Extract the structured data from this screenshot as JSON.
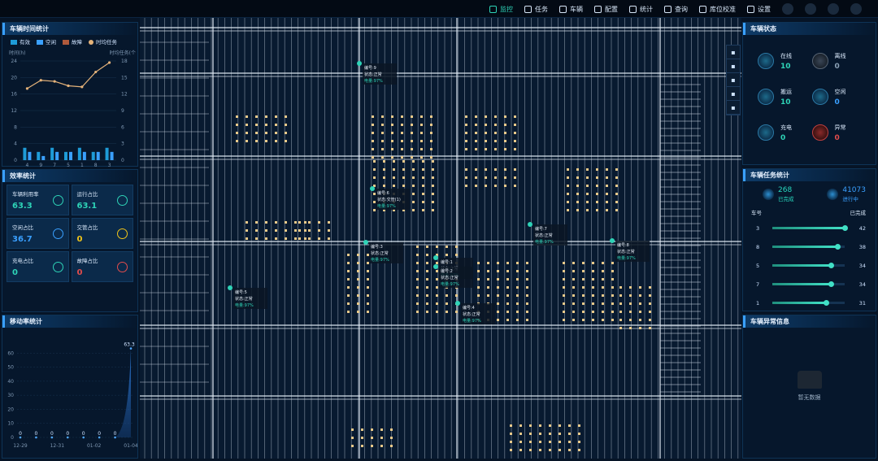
{
  "nav": {
    "items": [
      {
        "label": "监控",
        "icon": "monitor-icon",
        "active": true
      },
      {
        "label": "任务",
        "icon": "task-icon"
      },
      {
        "label": "车辆",
        "icon": "vehicle-icon"
      },
      {
        "label": "配置",
        "icon": "config-icon"
      },
      {
        "label": "统计",
        "icon": "stats-icon"
      },
      {
        "label": "查询",
        "icon": "query-icon"
      },
      {
        "label": "库位校准",
        "icon": "calibrate-icon"
      },
      {
        "label": "设置",
        "icon": "settings-icon"
      }
    ]
  },
  "vehicle_time": {
    "title": "车辆时间统计",
    "legend": [
      "有效",
      "空闲",
      "故障",
      "时均任务"
    ],
    "left_axis_label": "时间(h)",
    "right_axis_label": "时均任务(个",
    "colors": {
      "effective": "#1e9bd7",
      "idle": "#3aa0ff",
      "fault": "#b05a3c",
      "avg": "#e5b37a"
    }
  },
  "efficiency": {
    "title": "效率统计",
    "cells": [
      {
        "label": "车辆利用率",
        "value": "63.3",
        "color": "#2ed3b7",
        "icon": "utilization-icon"
      },
      {
        "label": "运行占比",
        "value": "63.1",
        "color": "#2ed3b7",
        "icon": "running-icon"
      },
      {
        "label": "空闲占比",
        "value": "36.7",
        "color": "#3aa0ff",
        "icon": "idle-icon"
      },
      {
        "label": "交管占比",
        "value": "0",
        "color": "#f0c419",
        "icon": "traffic-icon"
      },
      {
        "label": "充电占比",
        "value": "0",
        "color": "#2ed3b7",
        "icon": "charging-icon"
      },
      {
        "label": "故障占比",
        "value": "0",
        "color": "#e24c4c",
        "icon": "fault-icon"
      }
    ]
  },
  "mobility": {
    "title": "移动率统计"
  },
  "vehicle_status": {
    "title": "车辆状态",
    "items": [
      {
        "label": "在线",
        "value": "10",
        "color": "#2ed3b7",
        "icon": "online-icon"
      },
      {
        "label": "离线",
        "value": "0",
        "color": "#8aa0b4",
        "icon": "offline-icon"
      },
      {
        "label": "搬运",
        "value": "10",
        "color": "#2ed3b7",
        "icon": "carrying-icon"
      },
      {
        "label": "空闲",
        "value": "0",
        "color": "#3aa0ff",
        "icon": "idle-icon"
      },
      {
        "label": "充电",
        "value": "0",
        "color": "#2ed3b7",
        "icon": "charging-icon"
      },
      {
        "label": "异常",
        "value": "0",
        "color": "#e24c4c",
        "icon": "warning-icon"
      }
    ]
  },
  "task_stats": {
    "title": "车辆任务统计",
    "done_value": "268",
    "done_label": "已完成",
    "running_value": "41073",
    "running_label": "进行中",
    "col_vehicle": "车号",
    "col_done": "已完成",
    "rows": [
      {
        "vehicle": "3",
        "count": "42",
        "fraction": 1.0
      },
      {
        "vehicle": "8",
        "count": "38",
        "fraction": 0.9
      },
      {
        "vehicle": "5",
        "count": "34",
        "fraction": 0.81
      },
      {
        "vehicle": "7",
        "count": "34",
        "fraction": 0.81
      },
      {
        "vehicle": "1",
        "count": "31",
        "fraction": 0.74
      }
    ]
  },
  "anomaly": {
    "title": "车辆异常信息",
    "empty_text": "暂无数据"
  },
  "map_tools": [
    "layers-icon",
    "route-icon",
    "pin-icon",
    "chart-icon",
    "clipboard-icon"
  ],
  "vehicle_labels": [
    {
      "line1": "编号:9",
      "line2": "状态:正常",
      "line3": "电量:97%"
    },
    {
      "line1": "编号:6",
      "line2": "状态:交管(1)",
      "line3": "电量:97%"
    },
    {
      "line1": "编号:3",
      "line2": "状态:正常",
      "line3": "电量:97%"
    },
    {
      "line1": "编号:7",
      "line2": "状态:正常",
      "line3": "电量:97%"
    },
    {
      "line1": "编号:8",
      "line2": "状态:正常",
      "line3": "电量:97%"
    },
    {
      "line1": "编号:1",
      "line2": "状态:正常",
      "line3": "电量:97%"
    },
    {
      "line1": "编号:2",
      "line2": "状态:正常",
      "line3": "电量:97%"
    },
    {
      "line1": "编号:4",
      "line2": "状态:正常",
      "line3": "电量:97%"
    },
    {
      "line1": "编号:5",
      "line2": "状态:正常",
      "line3": "电量:97%"
    }
  ],
  "chart_data": [
    {
      "type": "bar",
      "title": "车辆时间统计",
      "ylabel": "时间(h)",
      "y2label": "时均任务(个",
      "ylim": [
        0,
        24
      ],
      "y2lim": [
        0,
        18
      ],
      "categories": [
        "4",
        "9",
        "7",
        "5",
        "1",
        "8",
        "3"
      ],
      "series": [
        {
          "name": "有效",
          "values": [
            3,
            2,
            3,
            2,
            3,
            2,
            3
          ]
        },
        {
          "name": "空闲",
          "values": [
            2,
            1,
            2,
            2,
            2,
            2,
            2
          ]
        },
        {
          "name": "故障",
          "values": [
            0,
            0,
            0,
            0,
            0,
            0,
            0
          ]
        },
        {
          "name": "时均任务",
          "type": "line",
          "values": [
            13,
            14.5,
            14.3,
            13.5,
            13.3,
            16,
            17.7
          ]
        }
      ],
      "yticks": [
        "0",
        "4",
        "8",
        "12",
        "16",
        "20",
        "24"
      ],
      "y2ticks": [
        "0",
        "3",
        "6",
        "9",
        "12",
        "15",
        "18"
      ]
    },
    {
      "type": "area",
      "title": "移动率统计",
      "ylim": [
        0,
        70
      ],
      "yticks": [
        "0",
        "10",
        "20",
        "30",
        "40",
        "50",
        "60"
      ],
      "x": [
        "12-29",
        "12-31",
        "01-02",
        "01-04"
      ],
      "values": [
        0,
        0,
        0,
        0,
        0,
        0,
        0,
        63.3
      ],
      "point_labels": [
        "0",
        "0",
        "0",
        "0",
        "0",
        "0",
        "0",
        "63.3"
      ]
    }
  ]
}
